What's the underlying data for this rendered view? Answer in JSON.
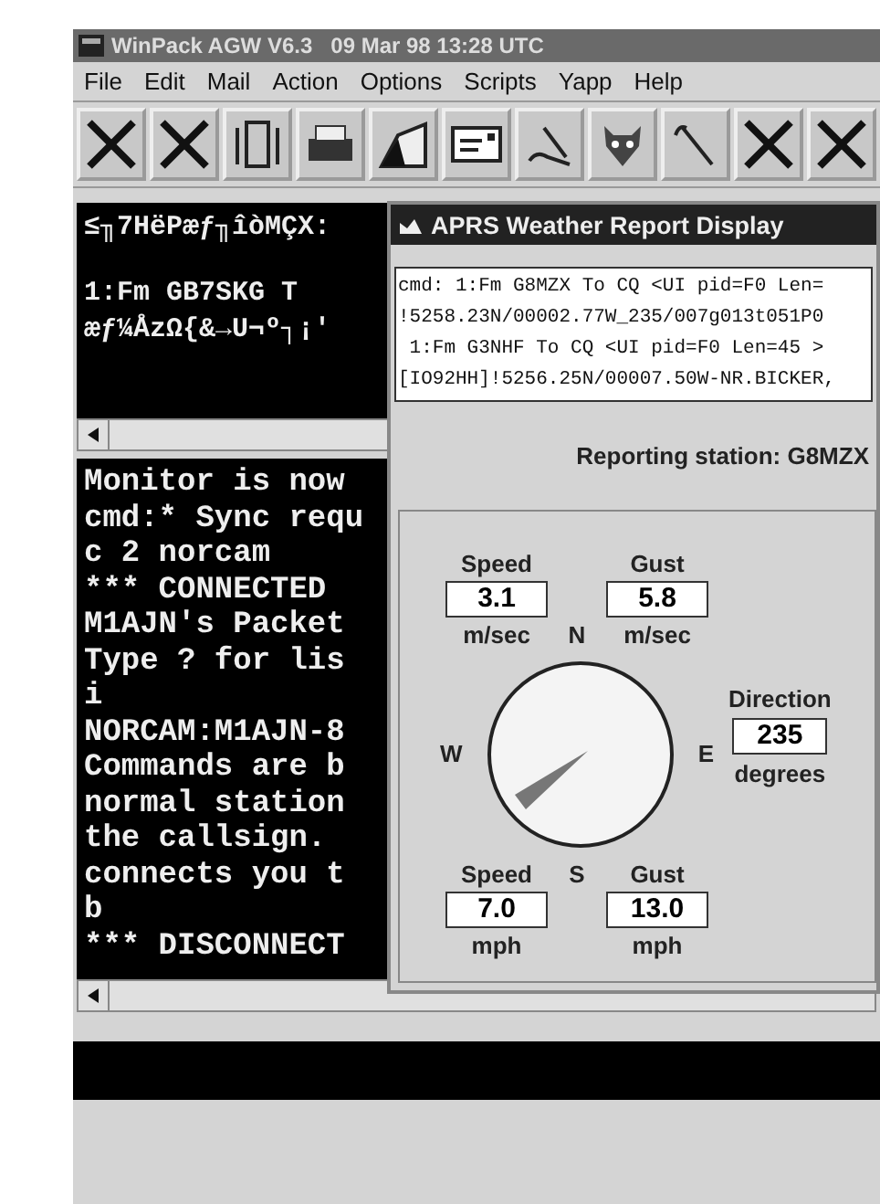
{
  "window": {
    "title": "WinPack AGW V6.3   09 Mar 98 13:28 UTC"
  },
  "menu": [
    "File",
    "Edit",
    "Mail",
    "Action",
    "Options",
    "Scripts",
    "Yapp",
    "Help"
  ],
  "top_pane": {
    "lines": [
      "≤╖7HëPæƒ╖îòMÇX:",
      "1:Fm GB7SKG T",
      "æƒ¼ÅzΩ{&→U¬º┐¡'"
    ]
  },
  "monitor_pane": {
    "lines": [
      "Monitor is now",
      "cmd:* Sync requ",
      "c 2 norcam",
      "*** CONNECTED",
      "M1AJN's Packet",
      "Type ? for lis",
      "i",
      "NORCAM:M1AJN-8",
      "Commands are b",
      "normal station",
      "the callsign.",
      "connects you t",
      "b",
      "*** DISCONNECT"
    ]
  },
  "dialog": {
    "title": "APRS Weather Report Display",
    "packet_lines": [
      "cmd: 1:Fm G8MZX To CQ <UI pid=F0 Len=",
      "!5258.23N/00002.77W_235/007g013t051P0",
      " 1:Fm G3NHF To CQ <UI pid=F0 Len=45 >",
      "[IO92HH]!5256.25N/00007.50W-NR.BICKER,"
    ],
    "reporting_station": "Reporting station: G8MZX",
    "wind": {
      "speed_label": "Speed",
      "gust_label": "Gust",
      "speed_ms": "3.1",
      "gust_ms": "5.8",
      "unit_ms_1": "m/sec",
      "unit_ms_2": "m/sec",
      "north": "N",
      "west": "W",
      "east": "E",
      "south": "S",
      "direction_label": "Direction",
      "direction": "235",
      "degrees_label": "degrees",
      "speed_label_2": "Speed",
      "gust_label_2": "Gust",
      "speed_mph": "7.0",
      "gust_mph": "13.0",
      "unit_mph_1": "mph",
      "unit_mph_2": "mph"
    }
  }
}
